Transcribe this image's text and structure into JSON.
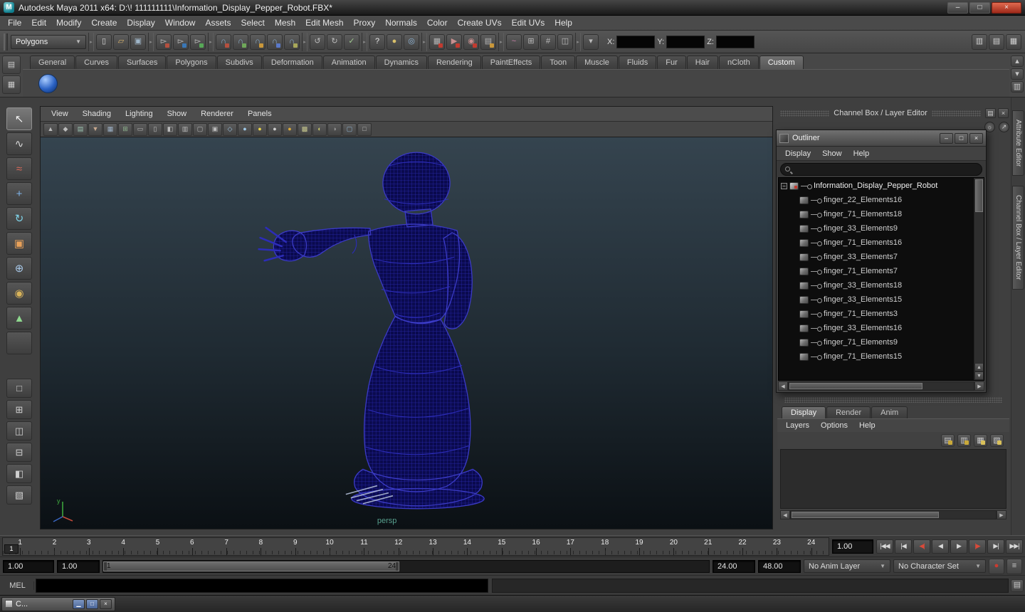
{
  "colors": {
    "viewport_top": "#35444f",
    "viewport_mid": "#1f2a32",
    "viewport_bottom": "#0b1014",
    "wireframe_fill": "#0a0a4e",
    "wireframe_grid": "#2c2cb8",
    "wireframe_edge": "#3b3bc6",
    "persp_label": "#58a08e"
  },
  "window": {
    "title": "Autodesk Maya 2011 x64: D:\\! 111111111\\Information_Display_Pepper_Robot.FBX*",
    "controls": [
      {
        "name": "minimize-button",
        "glyph": "–"
      },
      {
        "name": "maximize-button",
        "glyph": "□"
      },
      {
        "name": "close-button",
        "glyph": "×",
        "close": true
      }
    ]
  },
  "menubar": {
    "items": [
      "File",
      "Edit",
      "Modify",
      "Create",
      "Display",
      "Window",
      "Assets",
      "Select",
      "Mesh",
      "Edit Mesh",
      "Proxy",
      "Normals",
      "Color",
      "Create UVs",
      "Edit UVs",
      "Help"
    ]
  },
  "statusline": {
    "mode": "Polygons",
    "groups": [
      {
        "icons": [
          {
            "name": "new-scene-icon",
            "glyph": "▯",
            "fg": "#d8d8d8"
          },
          {
            "name": "open-scene-icon",
            "glyph": "▱",
            "fg": "#d9b36c"
          },
          {
            "name": "save-scene-icon",
            "glyph": "▣",
            "fg": "#9fb6c9"
          }
        ]
      },
      {
        "icons": [
          {
            "name": "select-by-hierarchy-icon",
            "glyph": "▻",
            "fg": "#c9c9c9",
            "mark": "#b5503f"
          },
          {
            "name": "select-by-object-icon",
            "glyph": "▻",
            "fg": "#c9c9c9",
            "mark": "#3a77b5"
          },
          {
            "name": "select-by-component-icon",
            "glyph": "▻",
            "fg": "#c9c9c9",
            "mark": "#57a857"
          }
        ]
      },
      {
        "icons": [
          {
            "name": "snap-to-grid-icon",
            "glyph": "∩",
            "fg": "#8fb3d1",
            "mark": "#b5503f"
          },
          {
            "name": "snap-to-curve-icon",
            "glyph": "∩",
            "fg": "#8fb3d1",
            "mark": "#6fa85a"
          },
          {
            "name": "snap-to-point-icon",
            "glyph": "∩",
            "fg": "#8fb3d1",
            "mark": "#c9973a"
          },
          {
            "name": "snap-to-view-plane-icon",
            "glyph": "∩",
            "fg": "#8fb3d1",
            "mark": "#5a79c9"
          },
          {
            "name": "make-live-icon",
            "glyph": "∩",
            "fg": "#8fb3d1",
            "mark": "#a8a85a"
          }
        ]
      },
      {
        "icons": [
          {
            "name": "input-to-selected-icon",
            "glyph": "↺",
            "fg": "#bcbcbc"
          },
          {
            "name": "output-from-selected-icon",
            "glyph": "↻",
            "fg": "#bcbcbc"
          },
          {
            "name": "construction-history-icon",
            "glyph": "✓",
            "fg": "#9fc98f"
          }
        ]
      },
      {
        "icons": [
          {
            "name": "quick-help-icon",
            "glyph": "?",
            "fg": "#ececec"
          },
          {
            "name": "lock-selection-icon",
            "glyph": "●",
            "fg": "#d9c06a"
          },
          {
            "name": "highlight-selection-icon",
            "glyph": "◎",
            "fg": "#8fb6d9"
          }
        ]
      },
      {
        "icons": [
          {
            "name": "open-render-view-icon",
            "glyph": "▦",
            "fg": "#b5b5b5",
            "mark": "#c23b30"
          },
          {
            "name": "render-current-frame-icon",
            "glyph": "▶",
            "fg": "#c98f8f",
            "mark": "#c23b30"
          },
          {
            "name": "ipr-render-icon",
            "glyph": "◉",
            "fg": "#c98f8f",
            "mark": "#c23b30"
          },
          {
            "name": "render-settings-icon",
            "glyph": "▤",
            "fg": "#b5b5b5",
            "mark": "#c9973a"
          }
        ]
      },
      {
        "icons": [
          {
            "name": "paint-effects-icon",
            "glyph": "~",
            "fg": "#c97fa7"
          },
          {
            "name": "toggle-modeling-toolkit-icon",
            "glyph": "⊞",
            "fg": "#bcbcbc"
          },
          {
            "name": "poly-count-icon",
            "glyph": "#",
            "fg": "#bcbcbc"
          },
          {
            "name": "symmetry-icon",
            "glyph": "◫",
            "fg": "#bcbcbc"
          }
        ]
      },
      {
        "icons": [
          {
            "name": "field-entry-mode-icon",
            "glyph": "▾",
            "fg": "#bcbcbc"
          }
        ]
      }
    ],
    "coords": {
      "x_label": "X:",
      "y_label": "Y:",
      "z_label": "Z:",
      "x_value": "",
      "y_value": "",
      "z_value": ""
    },
    "right_icons": [
      {
        "name": "toggle-attribute-editor-icon",
        "glyph": "▥",
        "fg": "#d0d0d0"
      },
      {
        "name": "toggle-tool-settings-icon",
        "glyph": "▤",
        "fg": "#d0d0d0"
      },
      {
        "name": "toggle-channel-box-icon",
        "glyph": "▦",
        "fg": "#d0d0d0"
      }
    ]
  },
  "shelf": {
    "left_buttons": [
      {
        "name": "shelf-tab-menu-icon",
        "glyph": "▤",
        "fg": "#c9c9c9"
      },
      {
        "name": "shelf-item-menu-icon",
        "glyph": "▦",
        "fg": "#c9c9c9"
      }
    ],
    "tabs": [
      "General",
      "Curves",
      "Surfaces",
      "Polygons",
      "Subdivs",
      "Deformation",
      "Animation",
      "Dynamics",
      "Rendering",
      "PaintEffects",
      "Toon",
      "Muscle",
      "Fluids",
      "Fur",
      "Hair",
      "nCloth",
      "Custom"
    ],
    "active_tab": "Custom",
    "right_buttons": [
      {
        "name": "shelf-scroll-up-icon",
        "glyph": "▴",
        "fg": "#c9c9c9"
      },
      {
        "name": "shelf-scroll-down-icon",
        "glyph": "▾",
        "fg": "#c9c9c9"
      },
      {
        "name": "shelf-editor-icon",
        "glyph": "▥",
        "fg": "#c9c9c9"
      }
    ]
  },
  "toolbox": {
    "tools": [
      {
        "name": "select-tool",
        "glyph": "↖",
        "fg": "#f2f2f2",
        "active": true
      },
      {
        "name": "lasso-select-tool",
        "glyph": "∿",
        "fg": "#d8d8d8"
      },
      {
        "name": "paint-select-tool",
        "glyph": "≈",
        "fg": "#d96a5a"
      },
      {
        "name": "move-tool",
        "glyph": "+",
        "fg": "#7fb3e8"
      },
      {
        "name": "rotate-tool",
        "glyph": "↻",
        "fg": "#7fd3e8"
      },
      {
        "name": "scale-tool",
        "glyph": "▣",
        "fg": "#e8a15a"
      },
      {
        "name": "universal-manipulator-tool",
        "glyph": "⊕",
        "fg": "#a8c8e8"
      },
      {
        "name": "soft-modification-tool",
        "glyph": "◉",
        "fg": "#d8b35a"
      },
      {
        "name": "show-manipulator-tool",
        "glyph": "▲",
        "fg": "#8fd98f"
      },
      {
        "name": "last-tool-used",
        "glyph": "",
        "fg": "#999999"
      }
    ],
    "layouts": [
      {
        "name": "layout-single-pane",
        "glyph": "□"
      },
      {
        "name": "layout-four-pane",
        "glyph": "⊞"
      },
      {
        "name": "layout-two-pane-side-by-side",
        "glyph": "◫"
      },
      {
        "name": "layout-two-pane-stacked",
        "glyph": "⊟"
      },
      {
        "name": "layout-outliner-persp",
        "glyph": "◧"
      },
      {
        "name": "layout-custom",
        "glyph": "▧"
      }
    ]
  },
  "viewport": {
    "menus": [
      "View",
      "Shading",
      "Lighting",
      "Show",
      "Renderer",
      "Panels"
    ],
    "toolbar": [
      {
        "name": "select-camera-icon",
        "glyph": "▲",
        "fg": "#bcbcbc"
      },
      {
        "name": "lock-camera-icon",
        "glyph": "◆",
        "fg": "#bcbcbc"
      },
      {
        "name": "camera-attributes-icon",
        "glyph": "▤",
        "fg": "#9fc9b5"
      },
      {
        "name": "bookmarks-icon",
        "glyph": "▼",
        "fg": "#c9a98f"
      },
      {
        "name": "image-plane-icon",
        "glyph": "▦",
        "fg": "#9fb3c9"
      },
      {
        "name": "grid-toggle-icon",
        "glyph": "⊞",
        "fg": "#8fb58f"
      },
      {
        "name": "film-gate-icon",
        "glyph": "▭",
        "fg": "#bcbcbc"
      },
      {
        "name": "resolution-gate-icon",
        "glyph": "▯",
        "fg": "#bcbcbc"
      },
      {
        "name": "gate-mask-icon",
        "glyph": "◧",
        "fg": "#bcbcbc"
      },
      {
        "name": "field-chart-icon",
        "glyph": "▥",
        "fg": "#bcbcbc"
      },
      {
        "name": "safe-action-icon",
        "glyph": "▢",
        "fg": "#bcbcbc"
      },
      {
        "name": "safe-title-icon",
        "glyph": "▣",
        "fg": "#bcbcbc"
      },
      {
        "name": "wireframe-mode-icon",
        "glyph": "◇",
        "fg": "#9fc9e8"
      },
      {
        "name": "smooth-shade-mode-icon",
        "glyph": "●",
        "fg": "#9fc9e8"
      },
      {
        "name": "default-material-icon",
        "glyph": "●",
        "fg": "#e8d44a"
      },
      {
        "name": "flat-shade-icon",
        "glyph": "●",
        "fg": "#cfcfcf"
      },
      {
        "name": "highlight-material-icon",
        "glyph": "●",
        "fg": "#d9a93a"
      },
      {
        "name": "textured-mode-icon",
        "glyph": "▩",
        "fg": "#c9c98f"
      },
      {
        "name": "use-all-lights-icon",
        "glyph": "◐",
        "fg": "#c9c96a"
      },
      {
        "name": "shadows-icon",
        "glyph": "◑",
        "fg": "#9a9a9a"
      },
      {
        "name": "xray-mode-icon",
        "glyph": "▢",
        "fg": "#8fb3d1"
      },
      {
        "name": "isolate-select-icon",
        "glyph": "□",
        "fg": "#bcbcbc"
      }
    ],
    "camera_label": "persp"
  },
  "channel_box": {
    "header": "Channel Box / Layer Editor",
    "header_buttons": [
      {
        "name": "panel-tearoff-icon",
        "glyph": "▤"
      },
      {
        "name": "panel-close-icon",
        "glyph": "×"
      }
    ],
    "manip_icons": [
      {
        "name": "channel-manip-circle-icon",
        "glyph": "○"
      },
      {
        "name": "channel-manip-arrow-icon",
        "glyph": "↗"
      }
    ],
    "side_tabs": [
      "Attribute Editor",
      "Channel Box / Layer Editor"
    ]
  },
  "outliner": {
    "title": "Outliner",
    "window_buttons": [
      {
        "name": "outliner-minimize-button",
        "glyph": "–"
      },
      {
        "name": "outliner-maximize-button",
        "glyph": "□"
      },
      {
        "name": "outliner-close-button",
        "glyph": "×"
      }
    ],
    "menus": [
      "Display",
      "Show",
      "Help"
    ],
    "search_value": "",
    "expand_glyph": "−",
    "root": "Information_Display_Pepper_Robot",
    "items": [
      "finger_22_Elements16",
      "finger_71_Elements18",
      "finger_33_Elements9",
      "finger_71_Elements16",
      "finger_33_Elements7",
      "finger_71_Elements7",
      "finger_33_Elements18",
      "finger_33_Elements15",
      "finger_71_Elements3",
      "finger_33_Elements16",
      "finger_71_Elements9",
      "finger_71_Elements15"
    ]
  },
  "layer_editor": {
    "tabs": [
      "Display",
      "Render",
      "Anim"
    ],
    "active_tab": "Display",
    "menus": [
      "Layers",
      "Options",
      "Help"
    ],
    "icons": [
      {
        "name": "layer-mode-icon",
        "glyph": "▤",
        "fg": "#c9c9c9",
        "mark": "#c9a93a"
      },
      {
        "name": "layer-options-icon",
        "glyph": "▥",
        "fg": "#c9c9c9",
        "mark": "#c9a93a"
      },
      {
        "name": "create-empty-layer-icon",
        "glyph": "▦",
        "fg": "#c9c9c9",
        "mark": "#d9c05a"
      },
      {
        "name": "create-layer-from-selected-icon",
        "glyph": "▧",
        "fg": "#c9c9c9",
        "mark": "#d9c05a"
      }
    ]
  },
  "timeline": {
    "frames": [
      1,
      2,
      3,
      4,
      5,
      6,
      7,
      8,
      9,
      10,
      11,
      12,
      13,
      14,
      15,
      16,
      17,
      18,
      19,
      20,
      21,
      22,
      23,
      24
    ],
    "current_frame": "1",
    "current_time": "1.00",
    "playback": [
      {
        "name": "go-to-start-button",
        "glyph": "|◀◀"
      },
      {
        "name": "step-back-frame-button",
        "glyph": "|◀"
      },
      {
        "name": "step-back-key-button",
        "glyph": "◀|",
        "red": true
      },
      {
        "name": "play-backwards-button",
        "glyph": "◀"
      },
      {
        "name": "play-forwards-button",
        "glyph": "▶"
      },
      {
        "name": "step-forward-key-button",
        "glyph": "|▶",
        "red": true
      },
      {
        "name": "step-forward-frame-button",
        "glyph": "▶|"
      },
      {
        "name": "go-to-end-button",
        "glyph": "▶▶|"
      }
    ]
  },
  "range_slider": {
    "anim_start": "1.00",
    "play_start": "1.00",
    "bar_start": "1",
    "bar_end": "24",
    "play_end": "24.00",
    "anim_end": "48.00",
    "anim_layer": "No Anim Layer",
    "character_set": "No Character Set",
    "icons": [
      {
        "name": "auto-keyframe-toggle-icon",
        "glyph": "●",
        "fg": "#cc3b30"
      },
      {
        "name": "animation-preferences-icon",
        "glyph": "≡",
        "fg": "#cccccc"
      }
    ]
  },
  "command_line": {
    "label": "MEL",
    "input_value": "",
    "result_value": ""
  },
  "taskbar": {
    "window_label": "C...",
    "buttons": [
      {
        "name": "taskbar-minimize-button",
        "glyph": "▁"
      },
      {
        "name": "taskbar-restore-button",
        "glyph": "□"
      },
      {
        "name": "taskbar-close-button",
        "glyph": "×",
        "gray": true
      }
    ]
  }
}
